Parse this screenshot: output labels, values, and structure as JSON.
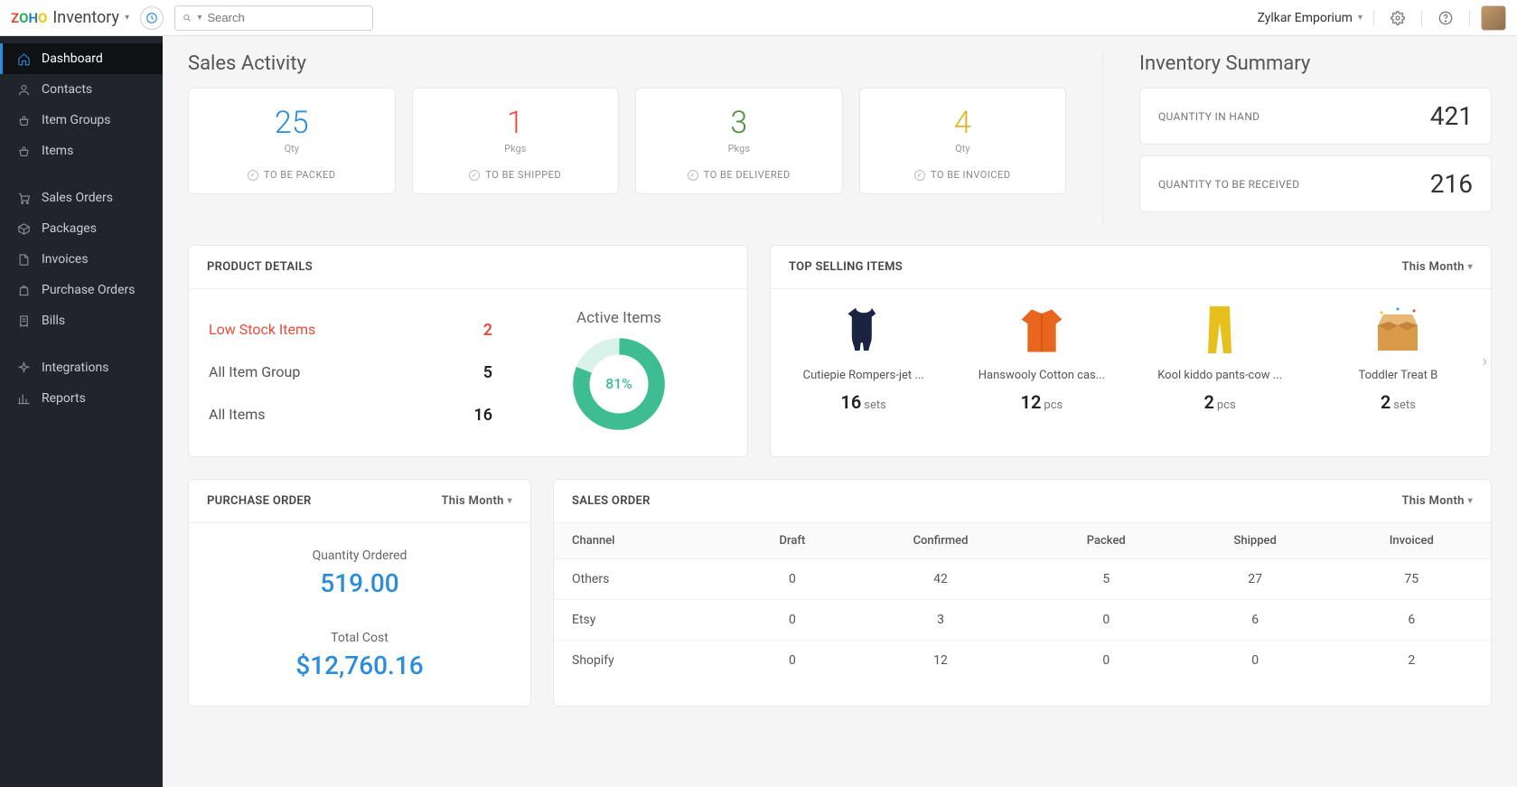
{
  "header": {
    "logo_text": "Inventory",
    "search_placeholder": "Search",
    "org_name": "Zylkar Emporium"
  },
  "sidebar": {
    "items": [
      {
        "label": "Dashboard",
        "icon": "home",
        "active": true
      },
      {
        "label": "Contacts",
        "icon": "user"
      },
      {
        "label": "Item Groups",
        "icon": "basket"
      },
      {
        "label": "Items",
        "icon": "basket"
      },
      {
        "gap": true
      },
      {
        "label": "Sales Orders",
        "icon": "cart"
      },
      {
        "label": "Packages",
        "icon": "box"
      },
      {
        "label": "Invoices",
        "icon": "file"
      },
      {
        "label": "Purchase Orders",
        "icon": "bag"
      },
      {
        "label": "Bills",
        "icon": "receipt"
      },
      {
        "gap": true
      },
      {
        "label": "Integrations",
        "icon": "spark"
      },
      {
        "label": "Reports",
        "icon": "chart"
      }
    ]
  },
  "sales_activity": {
    "title": "Sales Activity",
    "cards": [
      {
        "value": "25",
        "unit": "Qty",
        "label": "TO BE PACKED",
        "color": "blue"
      },
      {
        "value": "1",
        "unit": "Pkgs",
        "label": "TO BE SHIPPED",
        "color": "red"
      },
      {
        "value": "3",
        "unit": "Pkgs",
        "label": "TO BE DELIVERED",
        "color": "green"
      },
      {
        "value": "4",
        "unit": "Qty",
        "label": "TO BE INVOICED",
        "color": "yellow"
      }
    ]
  },
  "inventory_summary": {
    "title": "Inventory Summary",
    "rows": [
      {
        "label": "QUANTITY IN HAND",
        "value": "421"
      },
      {
        "label": "QUANTITY TO BE RECEIVED",
        "value": "216"
      }
    ]
  },
  "product_details": {
    "title": "PRODUCT DETAILS",
    "rows": [
      {
        "label": "Low Stock Items",
        "value": "2",
        "red": true
      },
      {
        "label": "All Item Group",
        "value": "5"
      },
      {
        "label": "All Items",
        "value": "16"
      }
    ],
    "donut": {
      "title": "Active Items",
      "percent": 81
    }
  },
  "top_selling": {
    "title": "TOP SELLING ITEMS",
    "period": "This Month",
    "items": [
      {
        "name": "Cutiepie Rompers-jet ...",
        "qty": "16",
        "unit": "sets",
        "img": "romper"
      },
      {
        "name": "Hanswooly Cotton cas...",
        "qty": "12",
        "unit": "pcs",
        "img": "shirt"
      },
      {
        "name": "Kool kiddo pants-cow ...",
        "qty": "2",
        "unit": "pcs",
        "img": "pants"
      },
      {
        "name": "Toddler Treat B",
        "qty": "2",
        "unit": "sets",
        "img": "box"
      }
    ]
  },
  "purchase_order": {
    "title": "PURCHASE ORDER",
    "period": "This Month",
    "qty_label": "Quantity Ordered",
    "qty_value": "519.00",
    "cost_label": "Total Cost",
    "cost_value": "$12,760.16"
  },
  "sales_order": {
    "title": "SALES ORDER",
    "period": "This Month",
    "columns": [
      "Channel",
      "Draft",
      "Confirmed",
      "Packed",
      "Shipped",
      "Invoiced"
    ],
    "rows": [
      {
        "channel": "Others",
        "values": [
          "0",
          "42",
          "5",
          "27",
          "75"
        ]
      },
      {
        "channel": "Etsy",
        "values": [
          "0",
          "3",
          "0",
          "6",
          "6"
        ]
      },
      {
        "channel": "Shopify",
        "values": [
          "0",
          "12",
          "0",
          "0",
          "2"
        ]
      }
    ]
  },
  "chart_data": {
    "type": "pie",
    "title": "Active Items",
    "series": [
      {
        "name": "Active",
        "value": 81
      },
      {
        "name": "Inactive",
        "value": 19
      }
    ]
  }
}
